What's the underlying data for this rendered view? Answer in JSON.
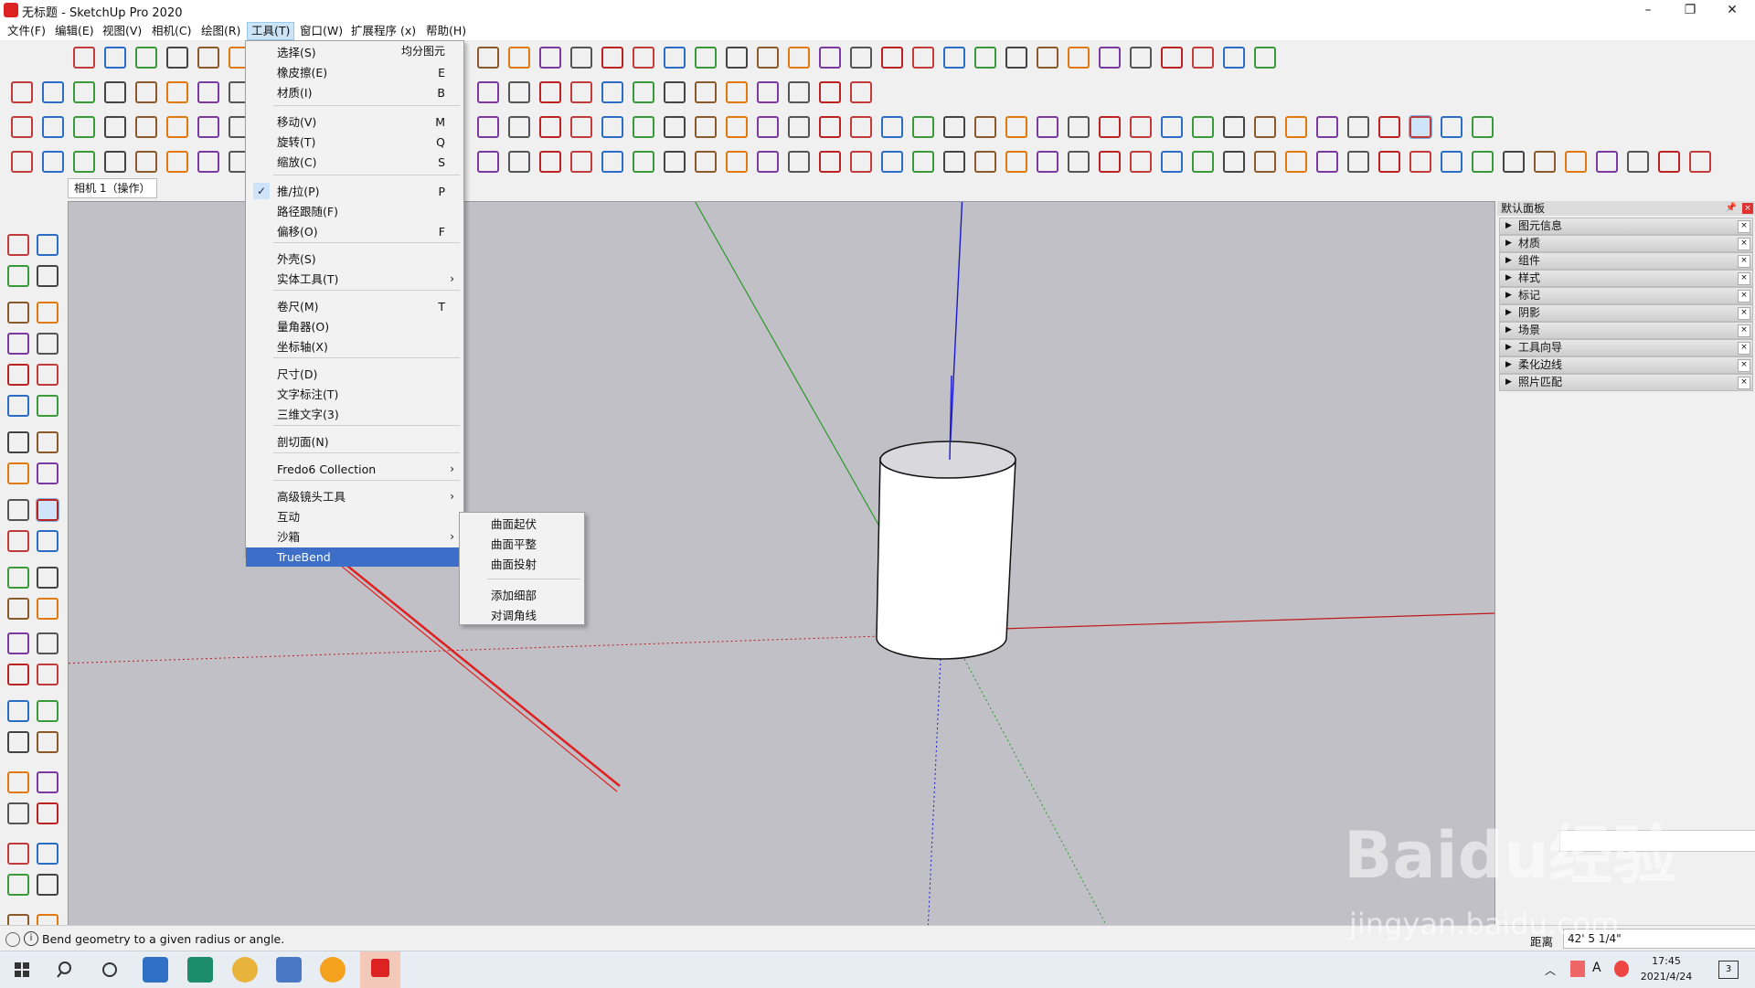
{
  "window": {
    "title": "无标题 - SketchUp Pro 2020"
  },
  "menubar": [
    {
      "label": "文件(F)"
    },
    {
      "label": "编辑(E)"
    },
    {
      "label": "视图(V)"
    },
    {
      "label": "相机(C)"
    },
    {
      "label": "绘图(R)"
    },
    {
      "label": "工具(T)"
    },
    {
      "label": "窗口(W)"
    },
    {
      "label": "扩展程序 (x)"
    },
    {
      "label": "帮助(H)"
    }
  ],
  "scene_tab": "相机 1（操作）",
  "tools_menu": {
    "header_right": "均分图元",
    "items": [
      {
        "label": "选择(S)",
        "shortcut": ""
      },
      {
        "label": "橡皮擦(E)",
        "shortcut": "E"
      },
      {
        "label": "材质(I)",
        "shortcut": "B"
      },
      {
        "label": "移动(V)",
        "shortcut": "M"
      },
      {
        "label": "旋转(T)",
        "shortcut": "Q"
      },
      {
        "label": "缩放(C)",
        "shortcut": "S"
      },
      {
        "label": "推/拉(P)",
        "shortcut": "P",
        "checked": true
      },
      {
        "label": "路径跟随(F)",
        "shortcut": ""
      },
      {
        "label": "偏移(O)",
        "shortcut": "F"
      },
      {
        "label": "外壳(S)",
        "shortcut": ""
      },
      {
        "label": "实体工具(T)",
        "submenu": true
      },
      {
        "label": "卷尺(M)",
        "shortcut": "T"
      },
      {
        "label": "量角器(O)",
        "shortcut": ""
      },
      {
        "label": "坐标轴(X)",
        "shortcut": ""
      },
      {
        "label": "尺寸(D)",
        "shortcut": ""
      },
      {
        "label": "文字标注(T)",
        "shortcut": ""
      },
      {
        "label": "三维文字(3)",
        "shortcut": ""
      },
      {
        "label": "剖切面(N)",
        "shortcut": ""
      },
      {
        "label": "Fredo6 Collection",
        "submenu": true
      },
      {
        "label": "高级镜头工具",
        "submenu": true
      },
      {
        "label": "互动",
        "shortcut": ""
      },
      {
        "label": "沙箱",
        "submenu": true
      },
      {
        "label": "TrueBend",
        "highlighted": true
      }
    ]
  },
  "sandbox_submenu": [
    {
      "label": "曲面起伏"
    },
    {
      "label": "曲面平整"
    },
    {
      "label": "曲面投射"
    },
    {
      "label": "添加细部"
    },
    {
      "label": "对调角线"
    }
  ],
  "tray": {
    "title": "默认面板",
    "panels": [
      {
        "label": "图元信息"
      },
      {
        "label": "材质"
      },
      {
        "label": "组件"
      },
      {
        "label": "样式"
      },
      {
        "label": "标记"
      },
      {
        "label": "阴影"
      },
      {
        "label": "场景"
      },
      {
        "label": "工具向导"
      },
      {
        "label": "柔化边线"
      },
      {
        "label": "照片匹配"
      }
    ],
    "close_glyph": "×"
  },
  "status": {
    "text": "Bend geometry to a given radius or angle.",
    "measure_label": "距离",
    "measure_value": "42' 5 1/4\""
  },
  "taskbar": {
    "time": "17:45",
    "date": "2021/4/24",
    "badge": "3"
  },
  "watermark": {
    "text": "Baidu经验",
    "url_text": "jingyan.baidu.com"
  },
  "colors": {
    "accent": "#3d6fc8",
    "viewport": "#c0c0c6",
    "red_arrow": "#e02020"
  }
}
